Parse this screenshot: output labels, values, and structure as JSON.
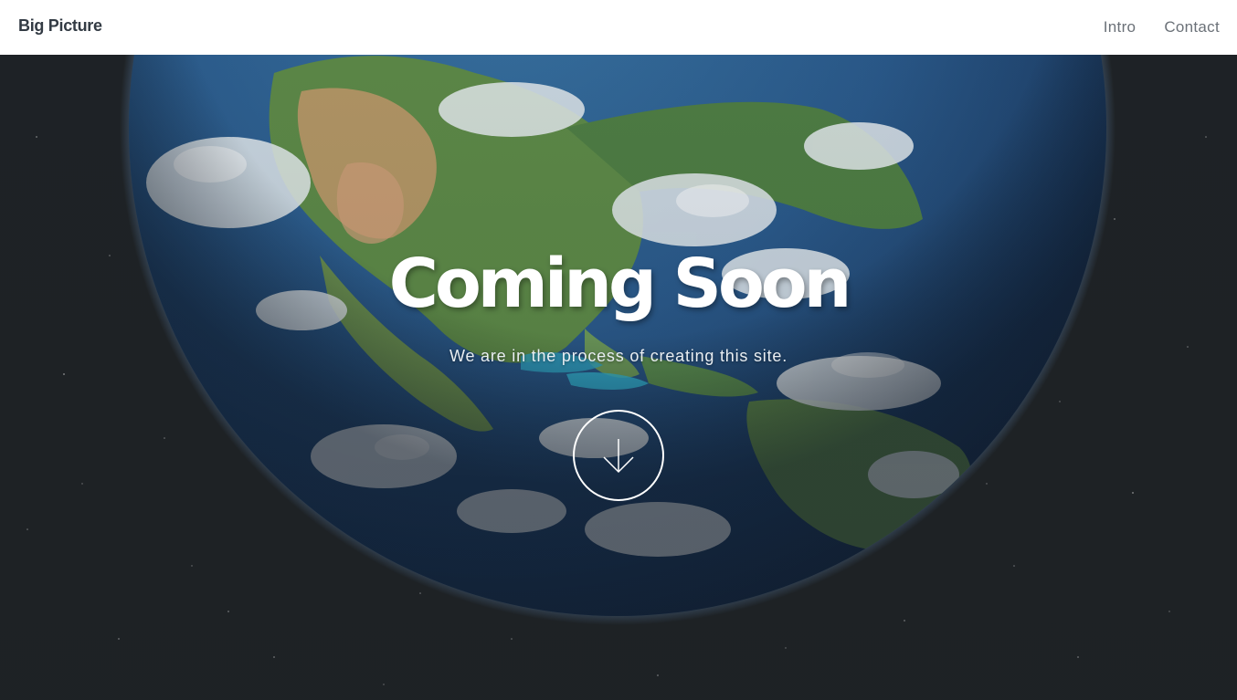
{
  "header": {
    "logo": "Big Picture",
    "nav": [
      {
        "label": "Intro"
      },
      {
        "label": "Contact"
      }
    ]
  },
  "hero": {
    "title": "Coming Soon",
    "subtitle": "We are in the process of creating this site.",
    "scroll_icon": "arrow-down-icon"
  },
  "colors": {
    "header_bg": "#ffffff",
    "logo": "#333b44",
    "nav_text": "#6b7178",
    "space_bg": "#1f2326",
    "ocean": "#2c5a86",
    "land": "#5f8a4a",
    "desert": "#c59a6a",
    "cloud": "#e6ecf0"
  }
}
